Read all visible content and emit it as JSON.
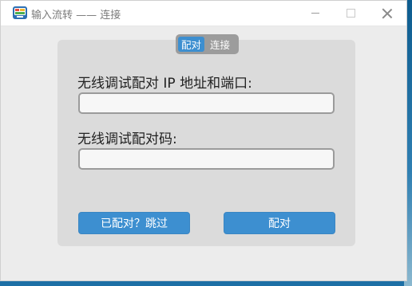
{
  "window": {
    "title": "输入流转 —— 连接",
    "controls": [
      "minimize",
      "maximize",
      "close"
    ]
  },
  "tabs": [
    {
      "label": "配对",
      "active": true
    },
    {
      "label": "连接",
      "active": false
    }
  ],
  "form": {
    "ip_port_label": "无线调试配对 IP 地址和端口:",
    "ip_port_value": "",
    "code_label": "无线调试配对码:",
    "code_value": ""
  },
  "buttons": {
    "skip_label": "已配对？跳过",
    "pair_label": "配对"
  },
  "colors": {
    "accent": "#3d8fd0",
    "panel": "#dbdbdb",
    "window_bg": "#ececec"
  },
  "icons": [
    "app-logo-icon",
    "minimize-icon",
    "maximize-icon",
    "close-icon"
  ]
}
